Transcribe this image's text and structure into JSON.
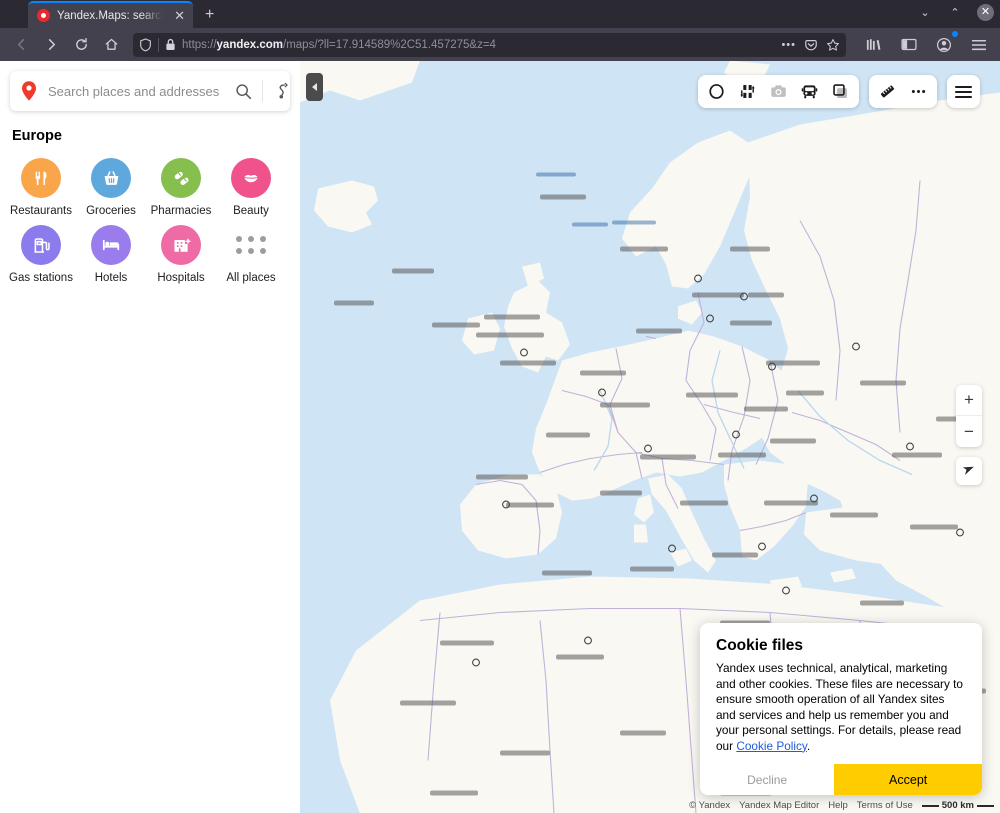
{
  "browser": {
    "tab": {
      "title": "Yandex.Maps: search for p",
      "close_label": "✕",
      "favicon_name": "yandex-maps-favicon"
    },
    "newtab_label": "+",
    "window_controls": {
      "minimize": "⌄",
      "maximize": "⌃",
      "close": "✕"
    },
    "nav": {
      "back": "←",
      "forward": "→",
      "reload": "⟳",
      "home": "⌂"
    },
    "url": {
      "scheme": "https://",
      "domain": "yandex.com",
      "path": "/maps/?ll=17.914589%2C51.457275&z=4",
      "full": "https://yandex.com/maps/?ll=17.914589%2C51.457275&z=4",
      "shield_icon": "tracking-protection-icon",
      "lock_icon": "lock-icon",
      "more_icon": "page-actions-icon",
      "pocket_icon": "pocket-icon",
      "bookmark_icon": "bookmark-star-icon"
    },
    "toolbar_right": {
      "library": "library-icon",
      "sidebar": "sidebar-icon",
      "account": "account-icon",
      "menu": "app-menu-icon"
    }
  },
  "sidebar": {
    "search": {
      "placeholder": "Search places and addresses",
      "value": "",
      "pin_icon": "map-pin-icon",
      "search_icon": "search-icon",
      "route_icon": "route-directions-icon"
    },
    "region_title": "Europe",
    "categories": [
      {
        "label": "Restaurants",
        "icon": "fork-knife-icon",
        "color": "#f9a64b"
      },
      {
        "label": "Groceries",
        "icon": "basket-icon",
        "color": "#5fa8dd"
      },
      {
        "label": "Pharmacies",
        "icon": "pills-icon",
        "color": "#87bf4e"
      },
      {
        "label": "Beauty",
        "icon": "lips-icon",
        "color": "#f0528c"
      },
      {
        "label": "Gas stations",
        "icon": "fuel-pump-icon",
        "color": "#8b7ced"
      },
      {
        "label": "Hotels",
        "icon": "bed-icon",
        "color": "#9a7ced"
      },
      {
        "label": "Hospitals",
        "icon": "hospital-icon",
        "color": "#ef6ba5"
      },
      {
        "label": "All places",
        "icon": "more-dots-icon",
        "color": "#9d9d9d"
      }
    ]
  },
  "map": {
    "collapse_panel_icon": "collapse-left-icon",
    "tools": [
      {
        "name": "traffic-icon",
        "disabled": false
      },
      {
        "name": "traffic-jams-icon",
        "disabled": false
      },
      {
        "name": "panorama-camera-icon",
        "disabled": true
      },
      {
        "name": "public-transport-icon",
        "disabled": false
      },
      {
        "name": "layers-icon",
        "disabled": false
      }
    ],
    "tools2": [
      {
        "name": "ruler-measure-icon",
        "disabled": false
      },
      {
        "name": "more-options-icon",
        "disabled": false
      }
    ],
    "menu_icon": "map-menu-icon",
    "zoom_in": "+",
    "zoom_out": "−",
    "locate_icon": "my-location-icon",
    "colors": {
      "water": "#cfe4f4",
      "land": "#faf8f2",
      "border": "#bfaed8",
      "accent_yellow": "#ffcc00"
    },
    "footer": {
      "copyright": "© Yandex",
      "map_editor": "Yandex Map Editor",
      "help": "Help",
      "terms": "Terms of Use",
      "scale": "500 km"
    }
  },
  "cookie_banner": {
    "title": "Cookie files",
    "text_before_link": "Yandex uses technical, analytical, marketing and other cookies. These files are necessary to ensure smooth operation of all Yandex sites and services and help us remember you and your personal settings. For details, please read our ",
    "link_label": "Cookie Policy",
    "text_after_link": ".",
    "decline_label": "Decline",
    "accept_label": "Accept"
  }
}
